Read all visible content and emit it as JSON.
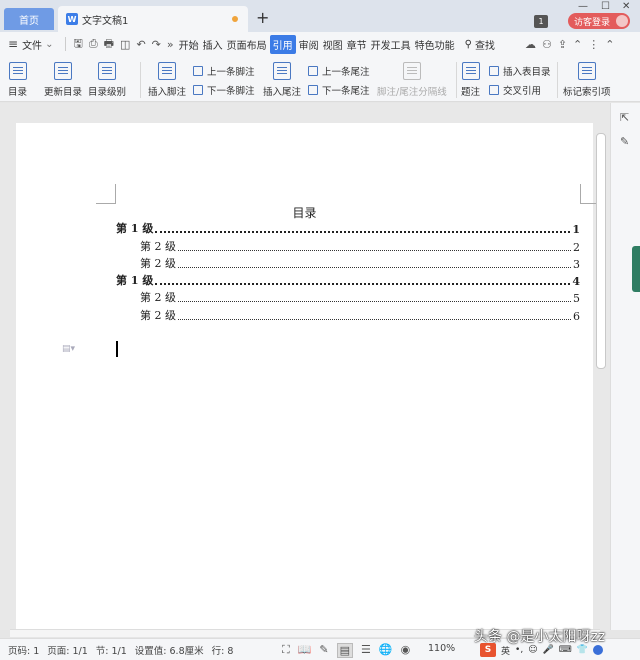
{
  "tabs": {
    "home": "首页",
    "document": "文字文稿1",
    "add": "+",
    "page_badge": "1",
    "login": "访客登录"
  },
  "menu": {
    "file": "文件",
    "tabs": [
      "开始",
      "插入",
      "页面布局",
      "引用",
      "审阅",
      "视图",
      "章节",
      "开发工具",
      "特色功能"
    ],
    "active_tab": "引用",
    "search": "查找"
  },
  "ribbon": {
    "toc": "目录",
    "update_toc": "更新目录",
    "toc_level": "目录级别",
    "insert_footnote": "插入脚注",
    "prev_footnote": "上一条脚注",
    "next_footnote": "下一条脚注",
    "insert_endnote": "插入尾注",
    "prev_endnote": "上一条尾注",
    "next_endnote": "下一条尾注",
    "footnote_separator": "脚注/尾注分隔线",
    "caption": "题注",
    "insert_table_of_figures": "插入表目录",
    "cross_reference": "交叉引用",
    "mark_index_entry": "标记索引项"
  },
  "document": {
    "toc_title": "目录",
    "toc_entries": [
      {
        "text": "第 1 级",
        "page": "1",
        "level": 1
      },
      {
        "text": "第 2 级",
        "page": "2",
        "level": 2
      },
      {
        "text": "第 2 级",
        "page": "3",
        "level": 2
      },
      {
        "text": "第 1 级",
        "page": "4",
        "level": 1
      },
      {
        "text": "第 2 级",
        "page": "5",
        "level": 2
      },
      {
        "text": "第 2 级",
        "page": "6",
        "level": 2
      }
    ]
  },
  "status": {
    "page_no": "页码: 1",
    "pages": "页面: 1/1",
    "section": "节: 1/1",
    "setting": "设置值: 6.8厘米",
    "line": "行: 8",
    "zoom": "110%"
  },
  "overlay": {
    "watermark": "头条 @是小太阳呀zz",
    "ime_lang": "英"
  },
  "colors": {
    "accent": "#3b7be6",
    "home_tab": "#6f9be5",
    "login": "#e35c5c"
  }
}
